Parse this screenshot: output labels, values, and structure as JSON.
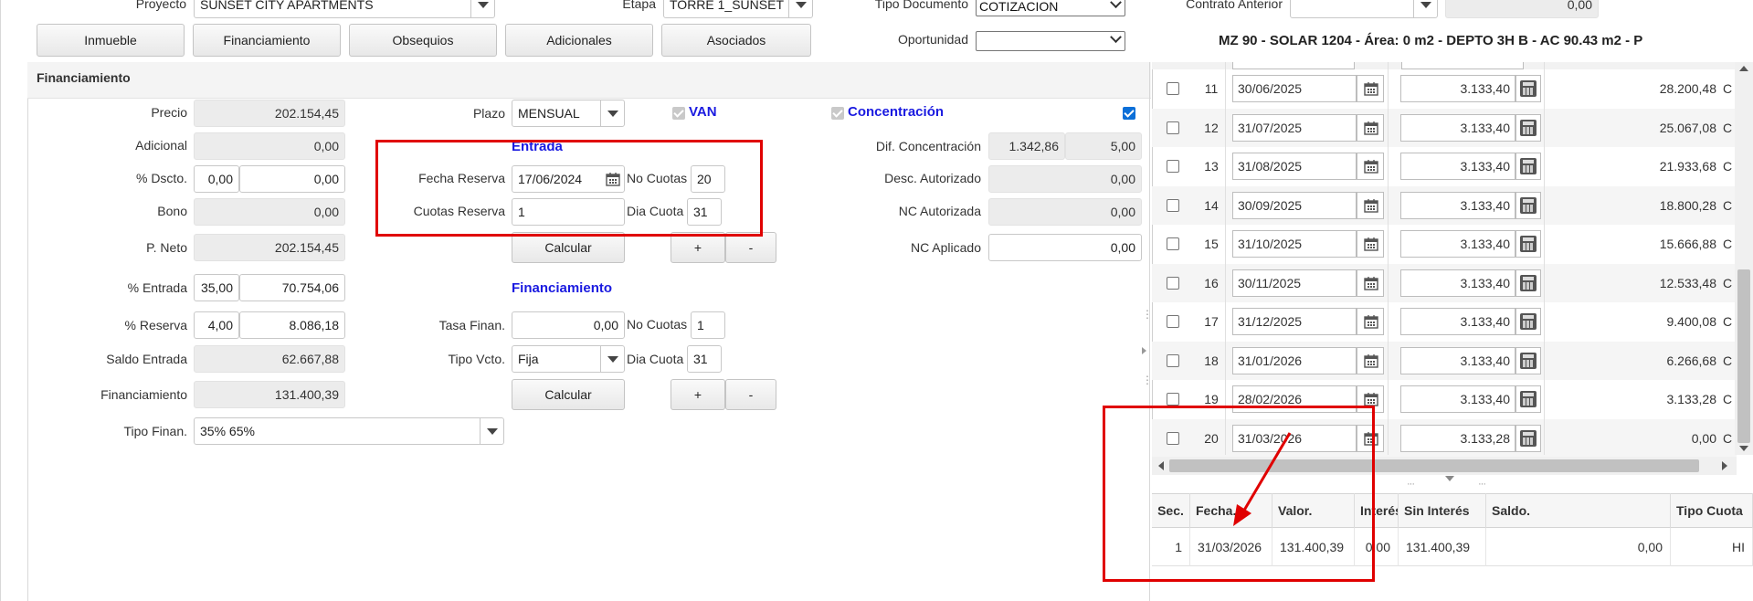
{
  "top": {
    "proyecto_label": "Proyecto",
    "proyecto_value": "SUNSET CITY APARTMENTS",
    "etapa_label": "Etapa",
    "etapa_value": "TORRE 1_SUNSET",
    "tipo_doc_label": "Tipo Documento",
    "tipo_doc_value": "COTIZACION",
    "contrato_label": "Contrato Anterior",
    "contrato_value": "",
    "contrato_amount": "0,00",
    "oportunidad_label": "Oportunidad",
    "oportunidad_value": "",
    "unit_title": "MZ 90 - SOLAR 1204 - Área: 0 m2 - DEPTO 3H B - AC 90.43 m2 - P"
  },
  "tabs": [
    "Inmueble",
    "Financiamiento",
    "Obsequios",
    "Adicionales",
    "Asociados"
  ],
  "section_title": "Financiamiento",
  "form": {
    "precio_label": "Precio",
    "precio": "202.154,45",
    "adicional_label": "Adicional",
    "adicional": "0,00",
    "dscto_label": "% Dscto.",
    "dscto_pct": "0,00",
    "dscto_val": "0,00",
    "bono_label": "Bono",
    "bono": "0,00",
    "pneto_label": "P. Neto",
    "pneto": "202.154,45",
    "entrada_label": "% Entrada",
    "entrada_pct": "35,00",
    "entrada_val": "70.754,06",
    "reserva_label": "% Reserva",
    "reserva_pct": "4,00",
    "reserva_val": "8.086,18",
    "saldo_label": "Saldo Entrada",
    "saldo": "62.667,88",
    "financiamiento_label": "Financiamiento",
    "financiamiento": "131.400,39",
    "tipo_finan_label": "Tipo Finan.",
    "tipo_finan": "35% 65%",
    "plazo_label": "Plazo",
    "plazo": "MENSUAL",
    "van_label": "VAN",
    "concentracion_label": "Concentración",
    "entrada_header": "Entrada",
    "fecha_reserva_label": "Fecha Reserva",
    "fecha_reserva": "17/06/2024",
    "no_cuotas_label": "No Cuotas",
    "no_cuotas": "20",
    "cuotas_reserva_label": "Cuotas Reserva",
    "cuotas_reserva": "1",
    "dia_cuota_label": "Dia Cuota",
    "dia_cuota": "31",
    "calcular": "Calcular",
    "plus": "+",
    "minus": "-",
    "financiamiento_header": "Financiamiento",
    "tasa_label": "Tasa Finan.",
    "tasa": "0,00",
    "no_cuotas2_label": "No Cuotas",
    "no_cuotas2": "1",
    "tipo_vcto_label": "Tipo Vcto.",
    "tipo_vcto": "Fija",
    "dia_cuota2_label": "Dia Cuota",
    "dia_cuota2": "31",
    "dif_conc_label": "Dif. Concentración",
    "dif_conc": "1.342,86",
    "dif_conc2": "5,00",
    "desc_aut_label": "Desc. Autorizado",
    "desc_aut": "0,00",
    "nc_aut_label": "NC Autorizada",
    "nc_aut": "0,00",
    "nc_apl_label": "NC Aplicado",
    "nc_apl": "0,00"
  },
  "schedule": [
    {
      "n": "11",
      "fecha": "30/06/2025",
      "valor": "3.133,40",
      "saldo": "28.200,48",
      "tipo": "C"
    },
    {
      "n": "12",
      "fecha": "31/07/2025",
      "valor": "3.133,40",
      "saldo": "25.067,08",
      "tipo": "C"
    },
    {
      "n": "13",
      "fecha": "31/08/2025",
      "valor": "3.133,40",
      "saldo": "21.933,68",
      "tipo": "C"
    },
    {
      "n": "14",
      "fecha": "30/09/2025",
      "valor": "3.133,40",
      "saldo": "18.800,28",
      "tipo": "C"
    },
    {
      "n": "15",
      "fecha": "31/10/2025",
      "valor": "3.133,40",
      "saldo": "15.666,88",
      "tipo": "C"
    },
    {
      "n": "16",
      "fecha": "30/11/2025",
      "valor": "3.133,40",
      "saldo": "12.533,48",
      "tipo": "C"
    },
    {
      "n": "17",
      "fecha": "31/12/2025",
      "valor": "3.133,40",
      "saldo": "9.400,08",
      "tipo": "C"
    },
    {
      "n": "18",
      "fecha": "31/01/2026",
      "valor": "3.133,40",
      "saldo": "6.266,68",
      "tipo": "C"
    },
    {
      "n": "19",
      "fecha": "28/02/2026",
      "valor": "3.133,40",
      "saldo": "3.133,28",
      "tipo": "C"
    },
    {
      "n": "20",
      "fecha": "31/03/2026",
      "valor": "3.133,28",
      "saldo": "0,00",
      "tipo": "C"
    }
  ],
  "fin_table": {
    "headers": [
      "Sec.",
      "Fecha.",
      "Valor.",
      "Interés",
      "Sin Interés",
      "Saldo.",
      "Tipo Cuota"
    ],
    "row": [
      "1",
      "31/03/2026",
      "131.400,39",
      "0,00",
      "131.400,39",
      "0,00",
      "HI"
    ]
  },
  "colors": {
    "accent_blue": "#1a1ae0",
    "highlight_red": "#e00000"
  }
}
